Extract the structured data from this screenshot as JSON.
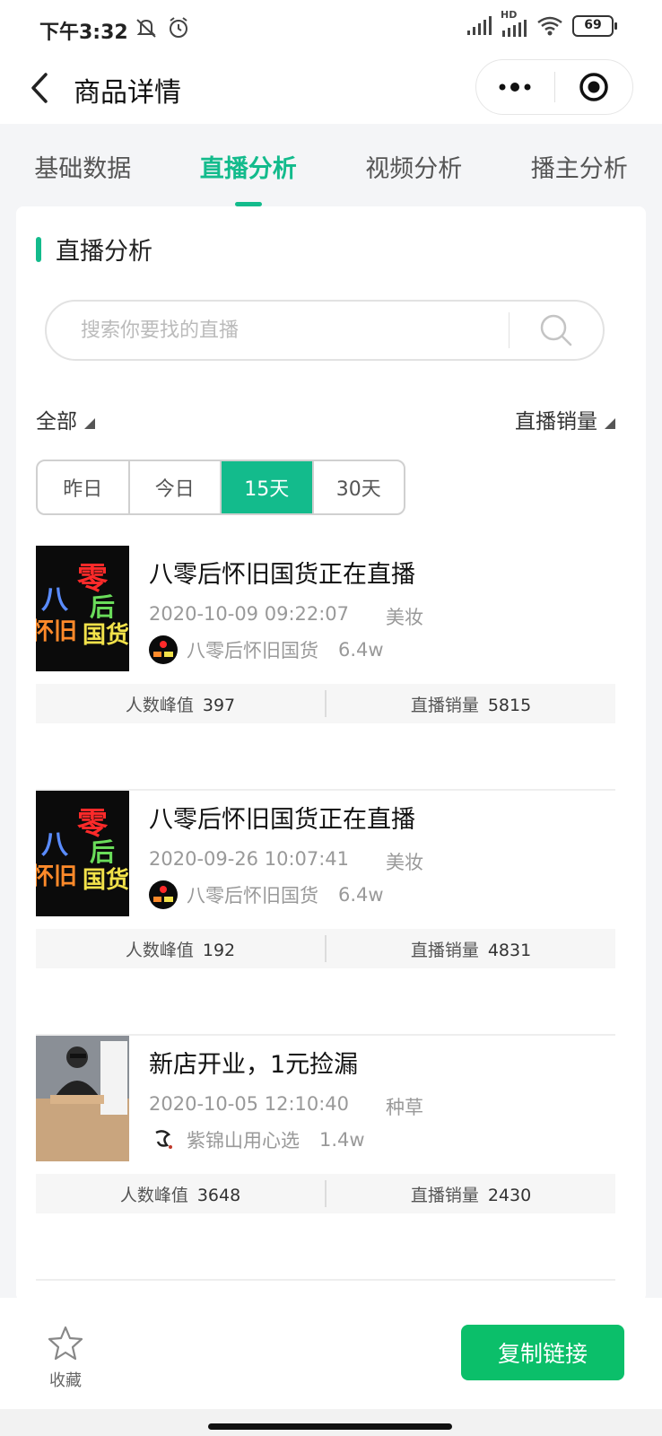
{
  "status_bar": {
    "time": "下午3:32",
    "network_label": "HD",
    "battery": "69"
  },
  "nav": {
    "title": "商品详情"
  },
  "tabs": [
    {
      "label": "基础数据",
      "active": false
    },
    {
      "label": "直播分析",
      "active": true
    },
    {
      "label": "视频分析",
      "active": false
    },
    {
      "label": "播主分析",
      "active": false
    }
  ],
  "section": {
    "title": "直播分析"
  },
  "search": {
    "placeholder": "搜索你要找的直播",
    "value": ""
  },
  "filters": {
    "category": "全部",
    "sort": "直播销量"
  },
  "time_segments": [
    {
      "label": "昨日",
      "active": false
    },
    {
      "label": "今日",
      "active": false
    },
    {
      "label": "15天",
      "active": true
    },
    {
      "label": "30天",
      "active": false
    }
  ],
  "live_list": [
    {
      "title": "八零后怀旧国货正在直播",
      "datetime": "2020-10-09 09:22:07",
      "category": "美妆",
      "anchor_name": "八零后怀旧国货",
      "anchor_fans": "6.4w",
      "peak_label": "人数峰值",
      "peak_value": "397",
      "sales_label": "直播销量",
      "sales_value": "5815",
      "cover_text": [
        "零",
        "八",
        "后",
        "怀旧",
        "国货"
      ]
    },
    {
      "title": "八零后怀旧国货正在直播",
      "datetime": "2020-09-26 10:07:41",
      "category": "美妆",
      "anchor_name": "八零后怀旧国货",
      "anchor_fans": "6.4w",
      "peak_label": "人数峰值",
      "peak_value": "192",
      "sales_label": "直播销量",
      "sales_value": "4831",
      "cover_text": [
        "零",
        "八",
        "后",
        "怀旧",
        "国货"
      ]
    },
    {
      "title": "新店开业，1元捡漏",
      "datetime": "2020-10-05 12:10:40",
      "category": "种草",
      "anchor_name": "紫锦山用心选",
      "anchor_fans": "1.4w",
      "peak_label": "人数峰值",
      "peak_value": "3648",
      "sales_label": "直播销量",
      "sales_value": "2430"
    }
  ],
  "bottom_bar": {
    "favorite_label": "收藏",
    "copy_label": "复制链接"
  },
  "colors": {
    "accent": "#13bb8c",
    "copy_button": "#0bbf6a"
  },
  "icons": [
    "dnd-bell-icon",
    "alarm-icon",
    "signal-icon",
    "wifi-icon",
    "back-arrow-icon",
    "more-icon",
    "target-icon",
    "search-icon",
    "star-icon"
  ]
}
